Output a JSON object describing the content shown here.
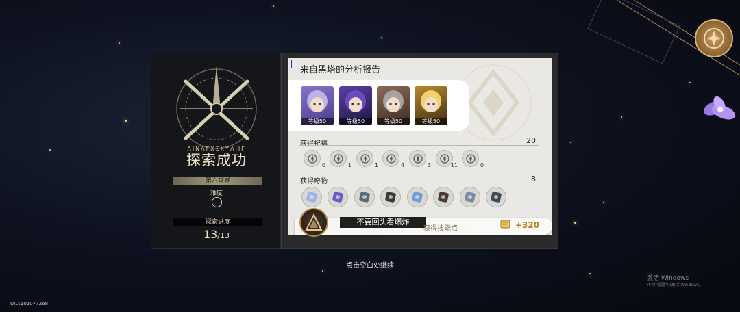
{
  "left_panel": {
    "rune_text": "ΛΙΝΛΓΧΣΧΥΛΙΙΓ",
    "result_title": "探索成功",
    "world": "第六世界",
    "difficulty_label": "难度",
    "difficulty_value": "I",
    "progress_label": "探索进度",
    "progress_current": "13",
    "progress_total": "/13"
  },
  "report": {
    "title": "来自黑塔的分析报告",
    "characters": [
      {
        "level": "等级50",
        "colors": [
          "#8a74c9",
          "#4b3a8c"
        ],
        "hair": "#b9b3e6"
      },
      {
        "level": "等级50",
        "colors": [
          "#5b3fa5",
          "#1d1640"
        ],
        "hair": "#6a4bc2"
      },
      {
        "level": "等级50",
        "colors": [
          "#8c6a55",
          "#3d2c24"
        ],
        "hair": "#a3a3a3"
      },
      {
        "level": "等级50",
        "colors": [
          "#b58b2f",
          "#3f2a15"
        ],
        "hair": "#f0d16b"
      }
    ],
    "blessings_label": "获得祝福",
    "blessings_total": "20",
    "blessings": [
      {
        "icon": "shield-rune-icon",
        "count": "0"
      },
      {
        "icon": "fist-rune-icon",
        "count": "1"
      },
      {
        "icon": "swirl-rune-icon",
        "count": "1"
      },
      {
        "icon": "wreath-rune-icon",
        "count": "4"
      },
      {
        "icon": "claw-rune-icon",
        "count": "3"
      },
      {
        "icon": "chain-rune-icon",
        "count": "11"
      },
      {
        "icon": "trophy-rune-icon",
        "count": "0"
      }
    ],
    "curios_label": "获得奇物",
    "curios_total": "8",
    "curios": [
      {
        "icon": "card-curio-icon"
      },
      {
        "icon": "web-curio-icon"
      },
      {
        "icon": "trash-curio-icon"
      },
      {
        "icon": "billiard-curio-icon"
      },
      {
        "icon": "tube-curio-icon"
      },
      {
        "icon": "box-curio-icon"
      },
      {
        "icon": "paint-curio-icon"
      },
      {
        "icon": "camera-curio-icon"
      }
    ],
    "toast": "不要回头看爆炸",
    "gain_label": "获得技能点",
    "points": "+320"
  },
  "continue_hint": "点击空白处继续",
  "uid": "UID:101077268",
  "watermark": {
    "line1": "激活 Windows",
    "line2": "转到\"设置\"以激活 Windows。"
  }
}
